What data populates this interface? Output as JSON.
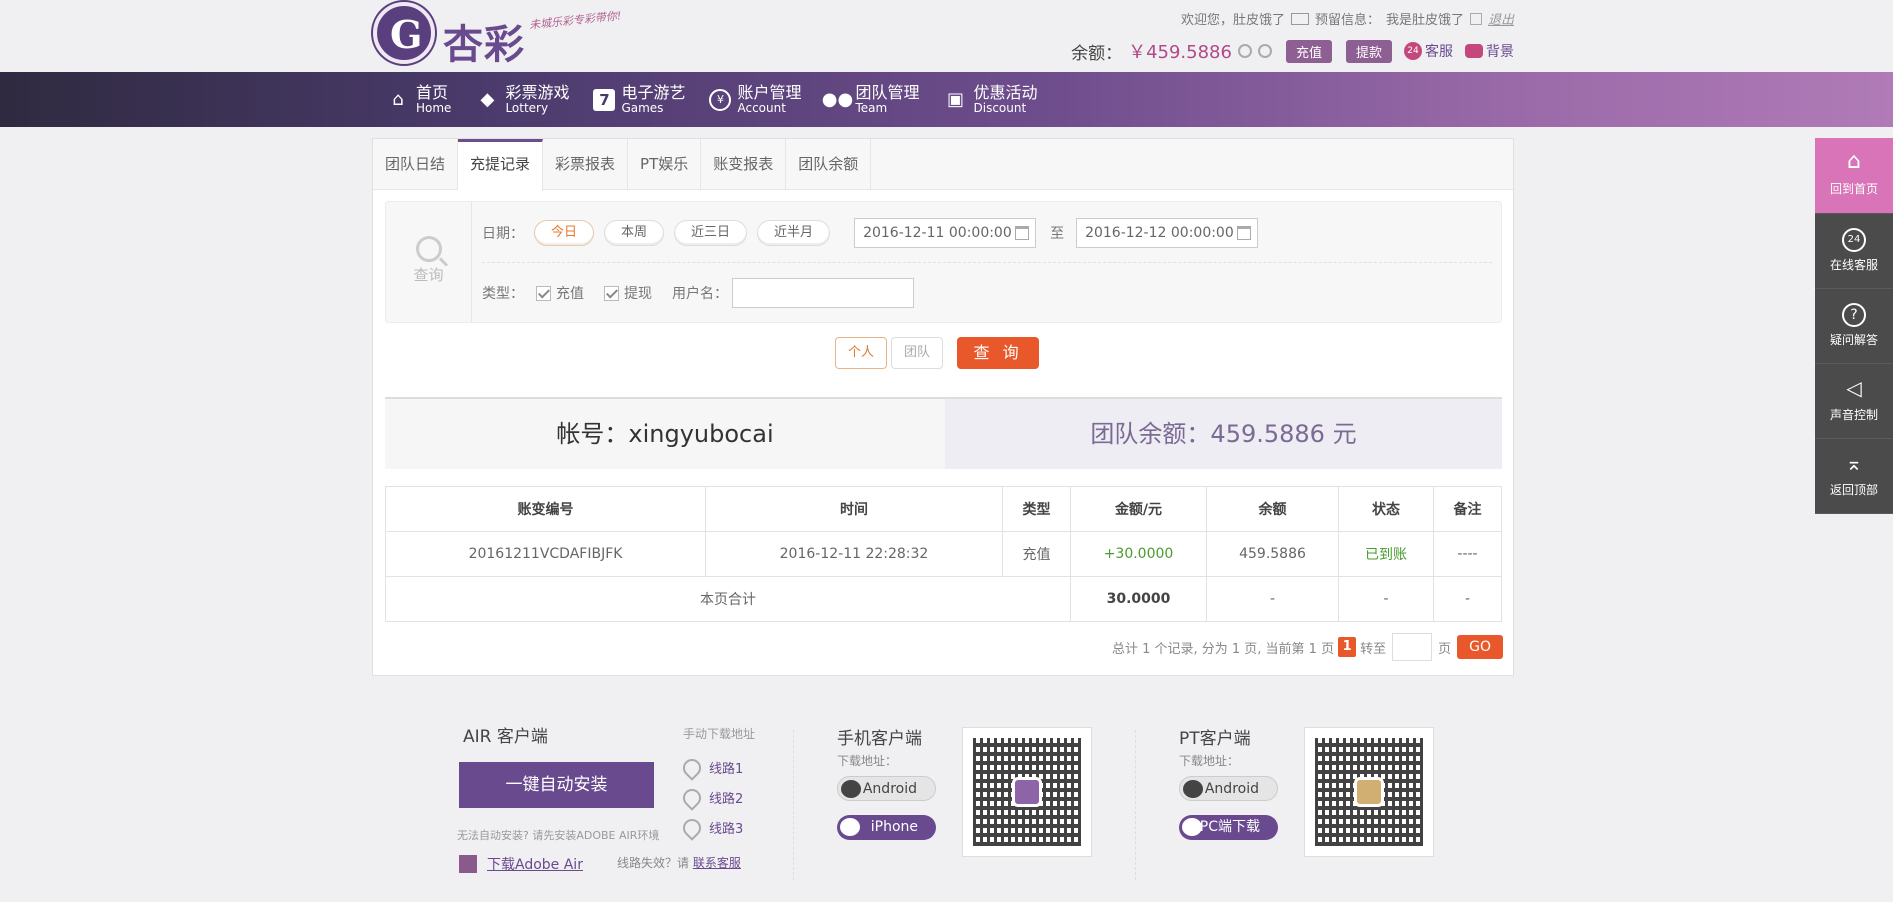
{
  "header": {
    "logo_text": "杏彩",
    "slogan": "未城乐彩专彩带你!",
    "welcome": "欢迎您，肚皮饿了",
    "reserve_label": "预留信息：",
    "reserve_value": "我是肚皮饿了",
    "logout": "退出",
    "balance_label": "余额：",
    "balance_value": "￥459.5886",
    "deposit": "充值",
    "withdraw": "提款",
    "service": "客服",
    "background": "背景"
  },
  "nav": [
    {
      "cn": "首页",
      "en": "Home",
      "icon": "home-icon"
    },
    {
      "cn": "彩票游戏",
      "en": "Lottery",
      "icon": "diamond-icon"
    },
    {
      "cn": "电子游艺",
      "en": "Games",
      "icon": "seven-icon"
    },
    {
      "cn": "账户管理",
      "en": "Account",
      "icon": "yen-icon"
    },
    {
      "cn": "团队管理",
      "en": "Team",
      "icon": "team-icon"
    },
    {
      "cn": "优惠活动",
      "en": "Discount",
      "icon": "gift-icon"
    }
  ],
  "tabs": [
    "团队日结",
    "充提记录",
    "彩票报表",
    "PT娱乐",
    "账变报表",
    "团队余额"
  ],
  "active_tab": "充提记录",
  "query": {
    "search_label": "查询",
    "date_label": "日期：",
    "ranges": [
      "今日",
      "本周",
      "近三日",
      "近半月"
    ],
    "start": "2016-12-11 00:00:00",
    "to": "至",
    "end": "2016-12-12 00:00:00",
    "type_label": "类型：",
    "type_deposit": "充值",
    "type_withdraw": "提现",
    "username_label": "用户名：",
    "username_value": "",
    "personal": "个人",
    "team": "团队",
    "submit": "查 询"
  },
  "summary": {
    "account": "帐号：xingyubocai",
    "team_balance": "团队余额：459.5886 元"
  },
  "table": {
    "headers": [
      "账变编号",
      "时间",
      "类型",
      "金额/元",
      "余额",
      "状态",
      "备注"
    ],
    "rows": [
      [
        "20161211VCDAFIBJFK",
        "2016-12-11 22:28:32",
        "充值",
        "+30.0000",
        "459.5886",
        "已到账",
        "----"
      ]
    ],
    "total_label": "本页合计",
    "total_amount": "30.0000",
    "total_rest": [
      "-",
      "-",
      "-"
    ]
  },
  "pager": {
    "text": "总计 1 个记录, 分为 1 页, 当前第 1 页",
    "current": "1",
    "goto": "转至",
    "page": "页",
    "go": "GO"
  },
  "sidebar": [
    "回到首页",
    "在线客服",
    "疑问解答",
    "声音控制",
    "返回顶部"
  ],
  "footer": {
    "air_title": "AIR 客户端",
    "manual": "手动下载地址",
    "install": "一键自动安装",
    "lines": [
      "线路1",
      "线路2",
      "线路3"
    ],
    "note": "无法自动安装? 请先安装ADOBE AIR环境",
    "adobe": "下载Adobe Air",
    "lost": "线路失效？请",
    "contact": "联系客服",
    "mobile_title": "手机客户端",
    "download_label": "下载地址：",
    "android": "Android",
    "iphone": "iPhone",
    "pt_title": "PT客户端",
    "pt_download_label": "下载地址：",
    "pt_android": "Android",
    "pc": "PC端下载"
  }
}
